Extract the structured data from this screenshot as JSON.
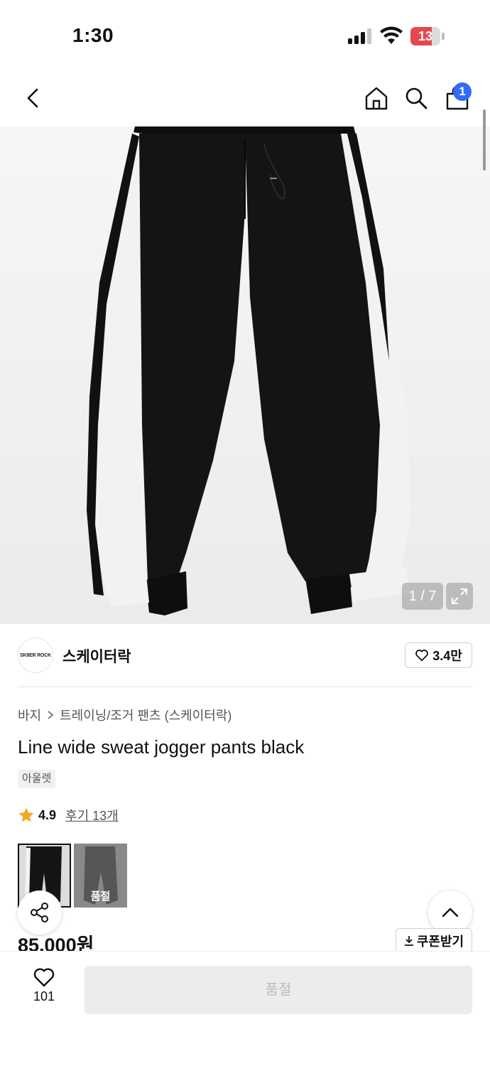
{
  "status_bar": {
    "time": "1:30",
    "battery_level": "13",
    "battery_color": "#e5484d"
  },
  "nav": {
    "back_icon": "chevron-left-icon",
    "home_icon": "home-icon",
    "search_icon": "search-icon",
    "cart_icon": "shopping-bag-icon",
    "cart_count": "1",
    "accent_color": "#2f6df6"
  },
  "gallery": {
    "counter": "1 / 7",
    "expand_icon": "expand-icon"
  },
  "brand": {
    "logo_text": "SK8ER ROCK",
    "name": "스케이터락",
    "likes": "3.4만"
  },
  "product": {
    "breadcrumb": [
      "바지",
      "트레이닝/조거 팬츠 (스케이터락)"
    ],
    "title": "Line wide sweat jogger pants black",
    "tag": "아울렛",
    "rating": "4.9",
    "review_link": "후기 13개",
    "colors": [
      {
        "name": "black",
        "label": "",
        "selected": true
      },
      {
        "name": "gray",
        "label": "품절",
        "selected": false
      }
    ],
    "price": "85,000원"
  },
  "actions": {
    "coupon_label": "쿠폰받기",
    "share_icon": "share-icon",
    "scroll_top_icon": "chevron-up-icon",
    "wish_count": "101",
    "buy_label": "품절"
  }
}
